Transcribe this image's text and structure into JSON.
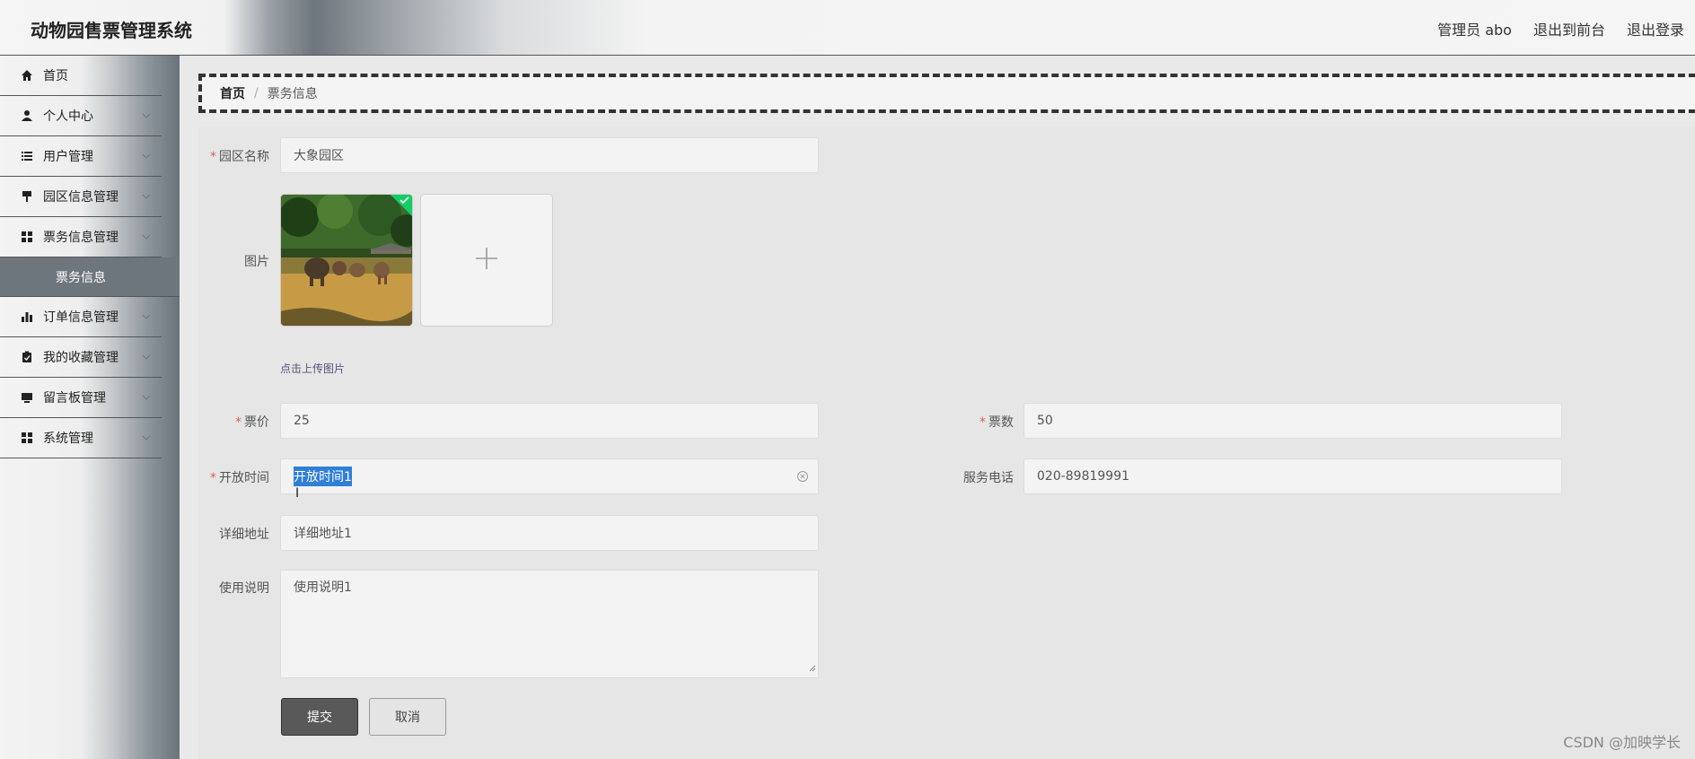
{
  "header": {
    "title": "动物园售票管理系统",
    "admin": "管理员 abo",
    "to_front": "退出到前台",
    "logout": "退出登录"
  },
  "sidebar": {
    "items": [
      {
        "label": "首页",
        "icon": "home-icon"
      },
      {
        "label": "个人中心",
        "icon": "user-icon"
      },
      {
        "label": "用户管理",
        "icon": "list-icon"
      },
      {
        "label": "园区信息管理",
        "icon": "pin-icon"
      },
      {
        "label": "票务信息管理",
        "icon": "grid-icon"
      },
      {
        "label": "票务信息",
        "icon": ""
      },
      {
        "label": "订单信息管理",
        "icon": "bar-chart-icon"
      },
      {
        "label": "我的收藏管理",
        "icon": "clipboard-icon"
      },
      {
        "label": "留言板管理",
        "icon": "monitor-icon"
      },
      {
        "label": "系统管理",
        "icon": "grid-icon"
      }
    ]
  },
  "breadcrumb": {
    "home": "首页",
    "separator": "/",
    "current": "票务信息"
  },
  "form": {
    "park_name": {
      "label": "园区名称",
      "value": "大象园区"
    },
    "image": {
      "label": "图片",
      "hint": "点击上传图片"
    },
    "price": {
      "label": "票价",
      "value": "25"
    },
    "count": {
      "label": "票数",
      "value": "50"
    },
    "open_time": {
      "label": "开放时间",
      "value": "开放时间1"
    },
    "phone": {
      "label": "服务电话",
      "value": "020-89819991"
    },
    "address": {
      "label": "详细地址",
      "value": "详细地址1"
    },
    "usage": {
      "label": "使用说明",
      "value": "使用说明1"
    },
    "submit": "提交",
    "cancel": "取消"
  },
  "watermark": "CSDN @加映学长",
  "colors": {
    "selection": "#2f7fd8",
    "required": "#e05c5c",
    "sidebar_active": "#6e767d"
  }
}
